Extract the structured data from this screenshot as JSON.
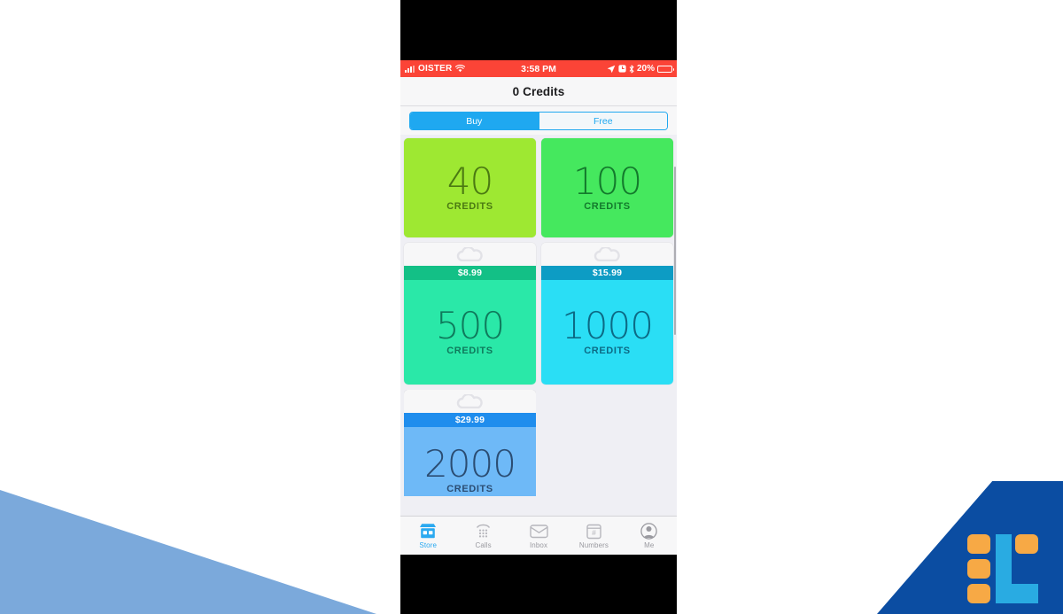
{
  "status_bar": {
    "carrier": "OISTER",
    "time": "3:58 PM",
    "battery_percent": "20%",
    "icons": [
      "signal-bars-icon",
      "wifi-icon",
      "location-arrow-icon",
      "alarm-icon",
      "bluetooth-icon",
      "battery-icon"
    ],
    "background_color": "#fb4437"
  },
  "navbar": {
    "title": "0 Credits"
  },
  "segmented_control": {
    "options": [
      {
        "label": "Buy",
        "active": true
      },
      {
        "label": "Free",
        "active": false
      }
    ],
    "accent_color": "#1fa8f0"
  },
  "store": {
    "credits_label": "CREDITS",
    "packages": [
      {
        "amount": "40",
        "credits_label": "CREDITS",
        "price": "",
        "card_color": "#9ee832",
        "price_bar_color": "#7cc20f",
        "text_color": "#4b7a12",
        "has_price_bar": false,
        "clipped": "top"
      },
      {
        "amount": "100",
        "credits_label": "CREDITS",
        "price": "",
        "card_color": "#45e85e",
        "price_bar_color": "#1fc23c",
        "text_color": "#137a2c",
        "has_price_bar": false,
        "clipped": "top"
      },
      {
        "amount": "500",
        "credits_label": "CREDITS",
        "price": "$8.99",
        "card_color": "#2ae8a8",
        "price_bar_color": "#13c086",
        "text_color": "#0f7a5c",
        "has_price_bar": true,
        "clipped": "none"
      },
      {
        "amount": "1000",
        "credits_label": "CREDITS",
        "price": "$15.99",
        "card_color": "#2adef5",
        "price_bar_color": "#0d9cc4",
        "text_color": "#0c6a85",
        "has_price_bar": true,
        "clipped": "none"
      },
      {
        "amount": "2000",
        "credits_label": "CREDITS",
        "price": "$29.99",
        "card_color": "#6eb9f7",
        "price_bar_color": "#1f8ded",
        "text_color": "#2b4d73",
        "has_price_bar": true,
        "clipped": "bottom"
      }
    ]
  },
  "tabbar": {
    "tabs": [
      {
        "label": "Store",
        "icon": "storefront-icon",
        "active": true
      },
      {
        "label": "Calls",
        "icon": "dialpad-phone-icon",
        "active": false
      },
      {
        "label": "Inbox",
        "icon": "inbox-tray-icon",
        "active": false
      },
      {
        "label": "Numbers",
        "icon": "hash-box-icon",
        "active": false
      },
      {
        "label": "Me",
        "icon": "person-circle-icon",
        "active": false
      }
    ],
    "active_color": "#2aa9f0",
    "inactive_color": "#9a9aa0"
  },
  "decorations": {
    "triangle_color": "#7ba9db",
    "corner_color": "#0b4da2",
    "logo_orange": "#f7a945",
    "logo_cyan": "#29abe2"
  }
}
